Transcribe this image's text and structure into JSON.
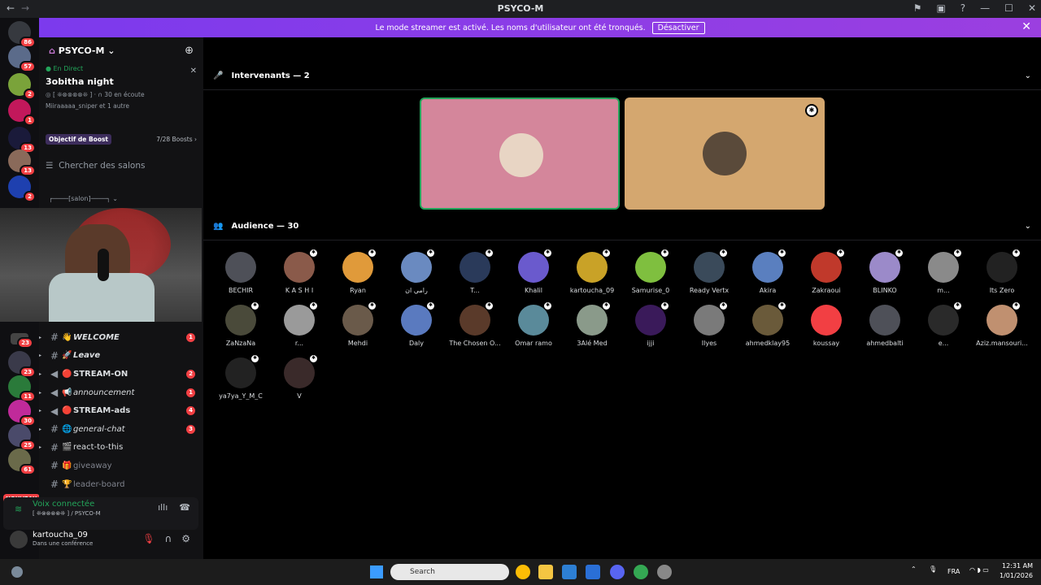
{
  "window": {
    "title": "PSYCO-M"
  },
  "banner": {
    "text": "Le mode streamer est activé. Les noms d'utilisateur ont été tronqués.",
    "button": "Désactiver"
  },
  "server_badges": [
    "86",
    "57",
    "2",
    "1",
    "13",
    "13",
    "2",
    "23",
    "23",
    "11",
    "30",
    "25",
    "61"
  ],
  "sidebar": {
    "guild_name": "PSYCO-M",
    "live_tag": "En Direct",
    "live_title": "3obitha night",
    "live_channel": "[ ❊⊗⊗⊗⊗❊ ]",
    "live_listeners": "30 en écoute",
    "live_users": "Miiraaaaa_sniper et 1 autre",
    "boost_label": "Objectif de Boost",
    "boost_count": "7/28 Boosts",
    "search_placeholder": "Chercher des salons",
    "section_title": "┌────[salon]────┐",
    "nouveau": "NOUVEAU",
    "channels": [
      {
        "name": "WELCOME",
        "emoji": "👋",
        "badge": "1",
        "type": "text"
      },
      {
        "name": "Leave",
        "emoji": "🚀",
        "badge": "",
        "type": "text"
      },
      {
        "name": "STREAM-ON",
        "emoji": "🔴",
        "badge": "2",
        "type": "announce"
      },
      {
        "name": "announcement",
        "emoji": "📢",
        "badge": "1",
        "type": "announce"
      },
      {
        "name": "STREAM-ads",
        "emoji": "🔴",
        "badge": "4",
        "type": "announce"
      },
      {
        "name": "general-chat",
        "emoji": "🌐",
        "badge": "3",
        "type": "text"
      },
      {
        "name": "react-to-this",
        "emoji": "🎬",
        "badge": "",
        "type": "text"
      },
      {
        "name": "giveaway",
        "emoji": "🎁",
        "badge": "",
        "type": "text"
      },
      {
        "name": "leader-board",
        "emoji": "🏆",
        "badge": "",
        "type": "text"
      }
    ],
    "voice_connected": "Voix connectée",
    "voice_sub": "[ ❊⊗⊗⊗⊗❊ ] / PSYCO-M",
    "username": "kartoucha_09",
    "user_status": "Dans une conférence"
  },
  "stage": {
    "speakers_title": "Intervenants — 2",
    "audience_title": "Audience — 30",
    "speakers": [
      {
        "bg": "#d4869b",
        "av": "#e8d5c4"
      },
      {
        "bg": "#d4a76f",
        "av": "#5a4a3a"
      }
    ],
    "audience": [
      {
        "name": "BECHIR",
        "color": "#4e5058"
      },
      {
        "name": "K A S H I",
        "color": "#8a5a4a"
      },
      {
        "name": "Ryan",
        "color": "#e09a3a"
      },
      {
        "name": "رامي ان",
        "color": "#6a8ac0"
      },
      {
        "name": "T...",
        "color": "#2a3a5a"
      },
      {
        "name": "Khalil",
        "color": "#6a5acd"
      },
      {
        "name": "kartoucha_09",
        "color": "#c9a227"
      },
      {
        "name": "Samurise_0",
        "color": "#7fbf3f"
      },
      {
        "name": "Ready Vertx",
        "color": "#3a4a5a"
      },
      {
        "name": "Akira",
        "color": "#5a7fbf"
      },
      {
        "name": "Zakraoui",
        "color": "#c0392b"
      },
      {
        "name": "BLINKO",
        "color": "#9b8ac9"
      },
      {
        "name": "m...",
        "color": "#8a8a8a"
      },
      {
        "name": "Its Zero",
        "color": "#222222"
      },
      {
        "name": "ZaNzaNa",
        "color": "#4a4a3a"
      },
      {
        "name": "r...",
        "color": "#9a9a9a"
      },
      {
        "name": "Mehdi",
        "color": "#6a5a4a"
      },
      {
        "name": "Daly",
        "color": "#5a7abf"
      },
      {
        "name": "The Chosen O...",
        "color": "#5a3a2a"
      },
      {
        "name": "Omar ramo",
        "color": "#5a8a9a"
      },
      {
        "name": "3Alé Med",
        "color": "#8a9a8a"
      },
      {
        "name": "ijji",
        "color": "#3a1a5a"
      },
      {
        "name": "Ilyes",
        "color": "#7a7a7a"
      },
      {
        "name": "ahmedklay95",
        "color": "#6a5a3a"
      },
      {
        "name": "koussay",
        "color": "#f23f43"
      },
      {
        "name": "ahmedbalti",
        "color": "#4e5058"
      },
      {
        "name": "e...",
        "color": "#2a2a2a"
      },
      {
        "name": "Aziz.mansouri...",
        "color": "#c09070"
      },
      {
        "name": "ya7ya_Y_M_C",
        "color": "#222222"
      },
      {
        "name": "V",
        "color": "#3a2a2a"
      }
    ]
  },
  "taskbar": {
    "search": "Search",
    "lang": "FRA",
    "time": "12:31 AM",
    "date": "1/01/2026"
  }
}
